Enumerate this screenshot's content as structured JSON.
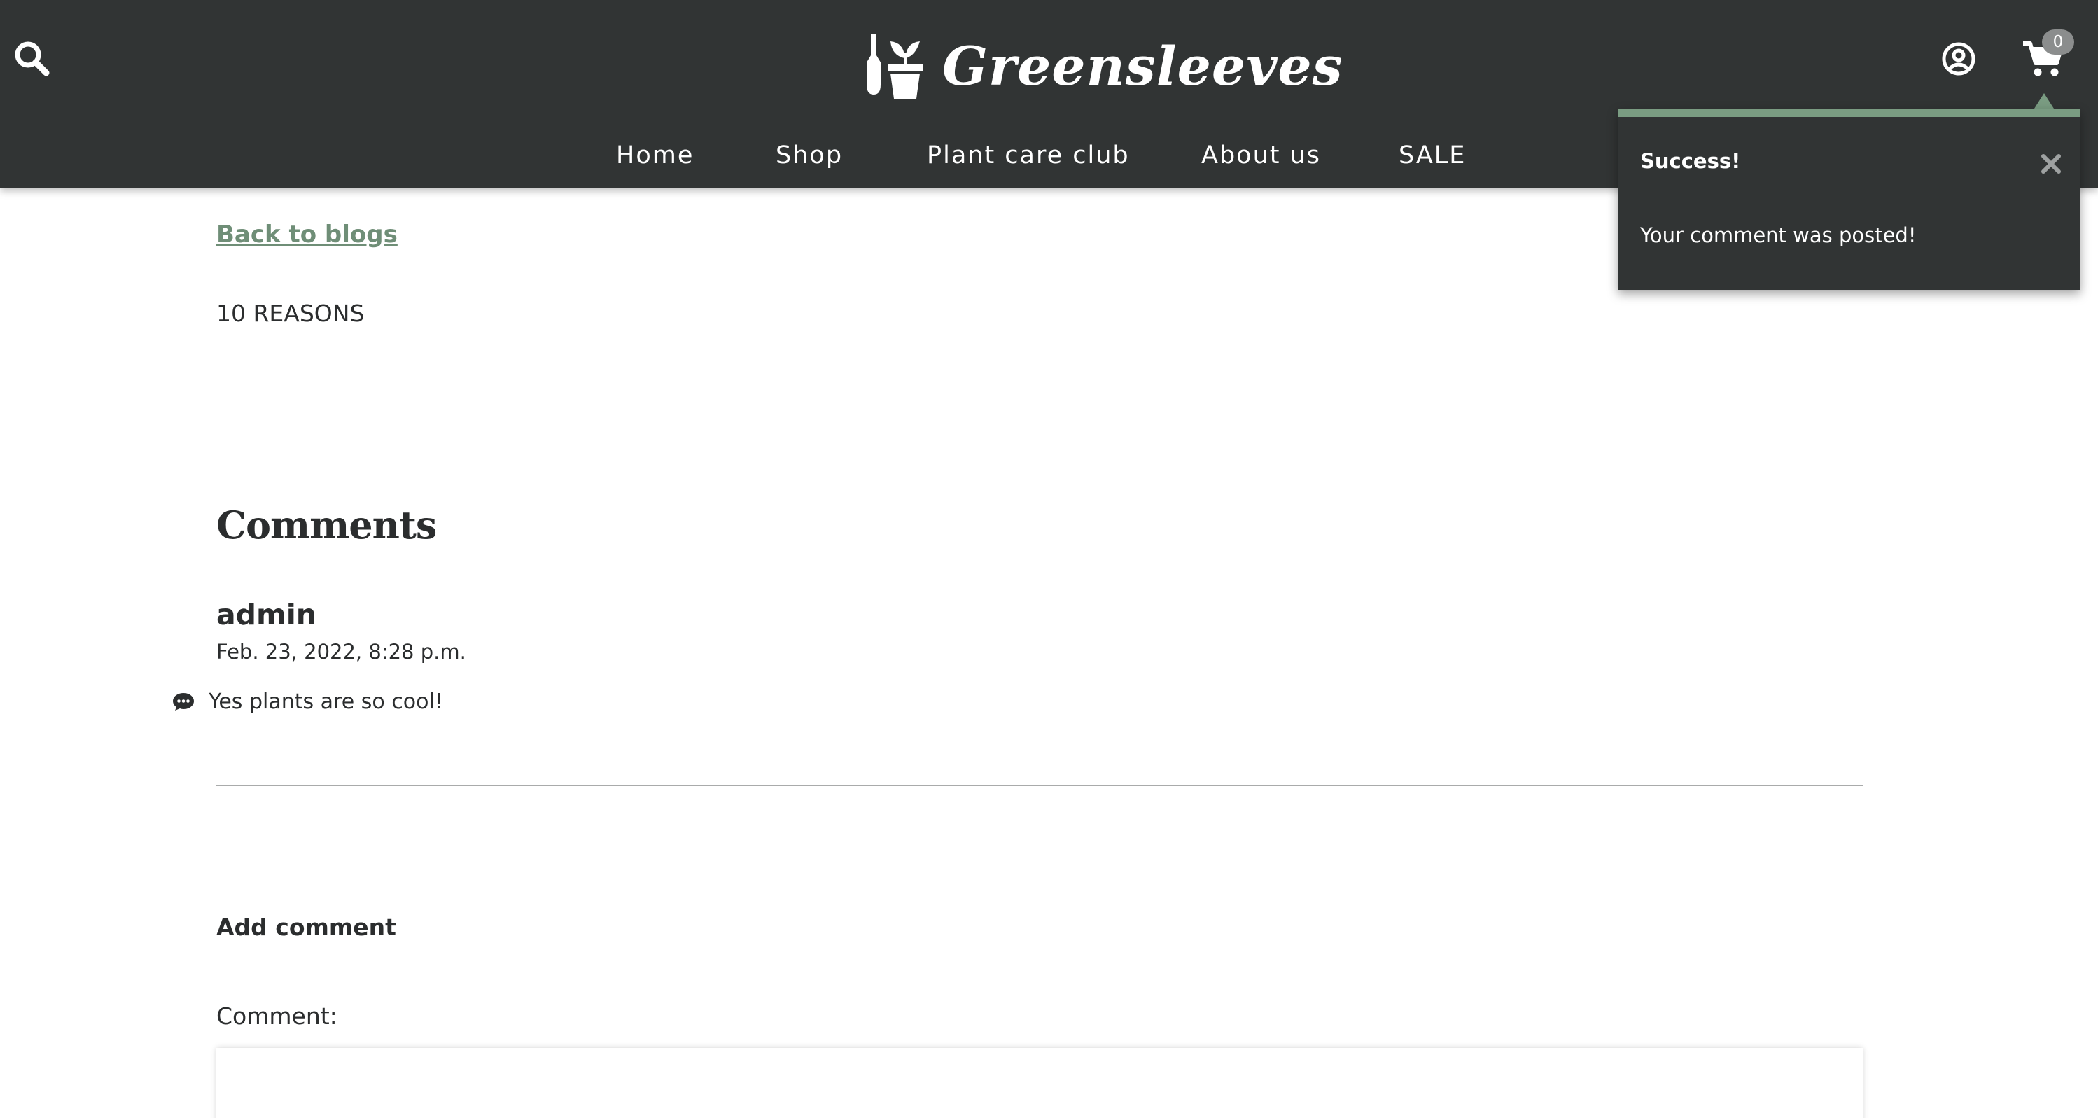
{
  "header": {
    "brand": "Greensleeves",
    "cart_count": "0",
    "nav": [
      {
        "label": "Home"
      },
      {
        "label": "Shop"
      },
      {
        "label": "Plant care club"
      },
      {
        "label": "About us"
      },
      {
        "label": "SALE"
      }
    ],
    "icons": {
      "search": "search-icon",
      "account": "user-circle-icon",
      "cart": "shopping-cart-icon",
      "logo": "plant-pot-icon"
    }
  },
  "toast": {
    "title": "Success!",
    "message": "Your comment was posted!"
  },
  "main": {
    "back_link": "Back to blogs",
    "post_title": "10 REASONS",
    "comments_heading": "Comments",
    "comments": [
      {
        "author": "admin",
        "date": "Feb. 23, 2022, 8:28 p.m.",
        "body": "Yes plants are so cool!"
      }
    ],
    "add_comment_heading": "Add comment",
    "comment_label": "Comment:",
    "comment_value": ""
  },
  "colors": {
    "header_bg": "#313434",
    "accent_green": "#7a9c82",
    "link_green": "#6f8e77",
    "text": "#2b2d2e"
  }
}
